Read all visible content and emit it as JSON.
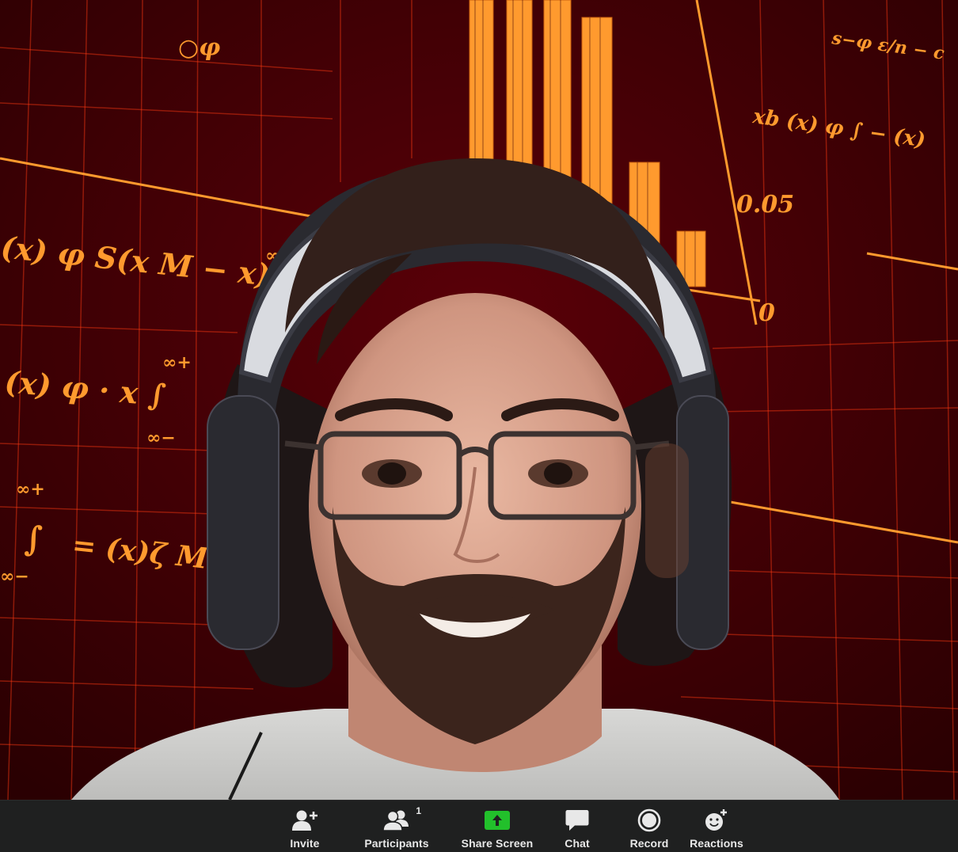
{
  "meeting": {
    "participant_count": "1"
  },
  "background": {
    "formula_1": "∞+",
    "formula_2": "(x) φ S(x M − x)",
    "formula_3": "(x) φ · x ∫",
    "formula_4": "∞−",
    "formula_5": "= (x)ζ M",
    "formula_6": "0.05",
    "formula_7": "0",
    "formula_8": "xb (x) φ ∫ − (x)",
    "formula_9": "φ",
    "accent_color": "#ff9a2e"
  },
  "toolbar": {
    "invite_label": "Invite",
    "participants_label": "Participants",
    "share_screen_label": "Share Screen",
    "chat_label": "Chat",
    "record_label": "Record",
    "reactions_label": "Reactions",
    "share_color": "#22c02b",
    "background_color": "#1f2020"
  }
}
